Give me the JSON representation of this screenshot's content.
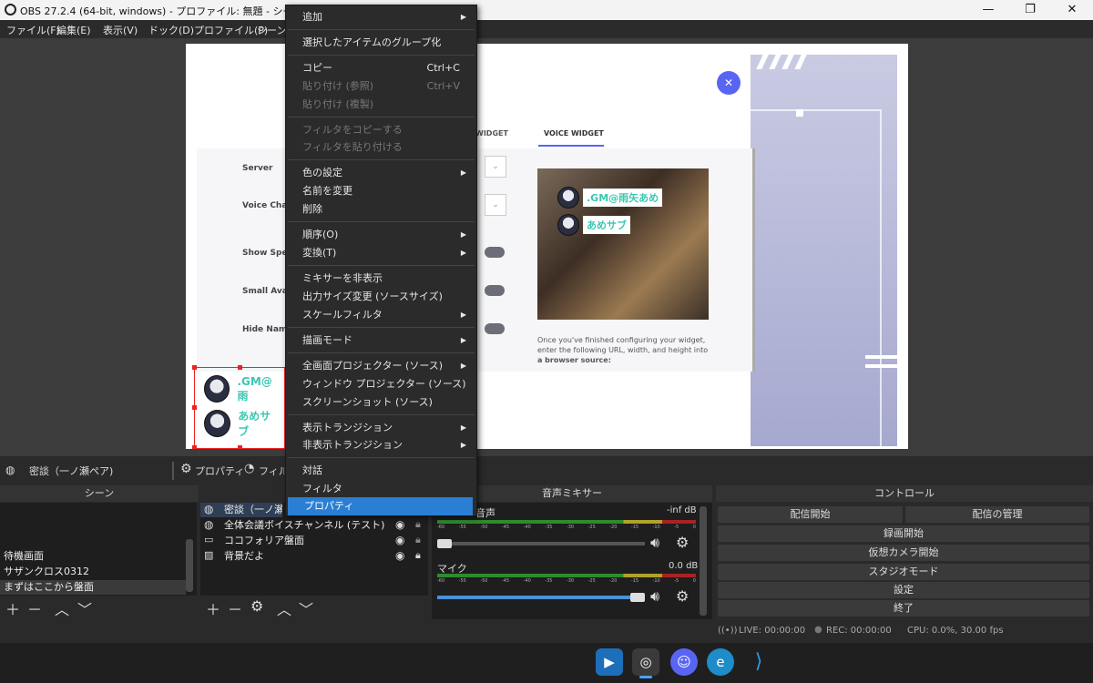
{
  "window": {
    "title": "OBS 27.2.4 (64-bit, windows) - プロファイル: 無題 - シーン: 無題",
    "minimize": "—",
    "maximize": "❐",
    "close": "✕"
  },
  "menubar": [
    "ファイル(F)",
    "編集(E)",
    "表示(V)",
    "ドック(D)",
    "プロファイル(P)",
    "シーンコ"
  ],
  "preview": {
    "widget_tab_left": "WIDGET",
    "widget_tab_active": "VOICE WIDGET",
    "form_labels": [
      "Server",
      "Voice Chan",
      "Show Spea",
      "Small Avat",
      "Hide Name"
    ],
    "voice_names": [
      ".GM@雨矢あめ",
      "あめサブ"
    ],
    "instructions_1": "Once you've finished configuring your widget,",
    "instructions_2": "enter the following URL, width, and height into",
    "instructions_3": "a browser source:",
    "overlay_names": [
      ".GM@雨",
      "あめサブ"
    ]
  },
  "source_toolbar": {
    "source_name": "密談（一ノ瀬ペア)",
    "properties": "プロパティ",
    "filters": "フィルタ"
  },
  "scenes": {
    "header": "シーン",
    "items": [
      "待機画面",
      "サザンクロス0312",
      "まずはここから盤面"
    ]
  },
  "sources": {
    "items": [
      "密談（一ノ瀬ペ",
      "全体会議ボイスチャンネル (テスト)",
      "ココフォリア盤面",
      "背景だよ"
    ]
  },
  "mixer": {
    "header": "音声ミキサー",
    "ch1_name": "音声",
    "ch1_level": "-inf dB",
    "ch2_name": "マイク",
    "ch2_level": "0.0 dB",
    "ticks": [
      "-60",
      "-55",
      "-50",
      "-45",
      "-40",
      "-35",
      "-30",
      "-25",
      "-20",
      "-15",
      "-10",
      "-5",
      "0"
    ],
    "ch1_volume": 0.0,
    "ch2_volume": 1.0
  },
  "controls": {
    "header": "コントロール",
    "start_stream": "配信開始",
    "manage_stream": "配信の管理",
    "start_record": "録画開始",
    "virtual_cam": "仮想カメラ開始",
    "studio_mode": "スタジオモード",
    "settings": "設定",
    "exit": "終了"
  },
  "status": {
    "live": "LIVE: 00:00:00",
    "rec": "REC: 00:00:00",
    "cpu": "CPU: 0.0%, 30.00 fps"
  },
  "context_menu": {
    "add": "追加",
    "group": "選択したアイテムのグループ化",
    "copy": "コピー",
    "copy_sc": "Ctrl+C",
    "paste_ref": "貼り付け (参照)",
    "paste_ref_sc": "Ctrl+V",
    "paste_dup": "貼り付け (複製)",
    "copy_filters": "フィルタをコピーする",
    "paste_filters": "フィルタを貼り付ける",
    "color": "色の設定",
    "rename": "名前を変更",
    "delete": "削除",
    "order": "順序(O)",
    "transform": "変換(T)",
    "hide_mixer": "ミキサーを非表示",
    "output_size": "出力サイズ変更 (ソースサイズ)",
    "scale_filter": "スケールフィルタ",
    "blend": "描画モード",
    "fs_projector": "全画面プロジェクター (ソース)",
    "win_projector": "ウィンドウ プロジェクター (ソース)",
    "screenshot": "スクリーンショット (ソース)",
    "show_trans": "表示トランジション",
    "hide_trans": "非表示トランジション",
    "interact": "対話",
    "filters": "フィルタ",
    "properties": "プロパティ"
  },
  "colors": {
    "selected": "#2a7fd4",
    "discord_blurple": "#5865f2",
    "teal_name": "#3ac8b2"
  }
}
